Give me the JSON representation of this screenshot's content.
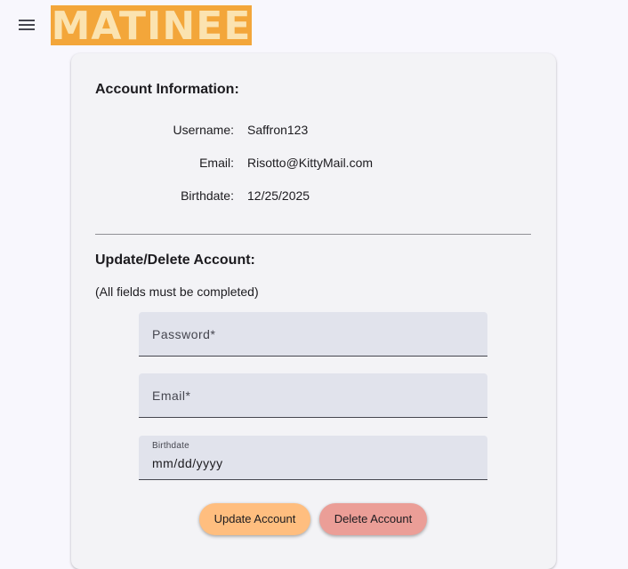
{
  "header": {
    "menu_icon": "hamburger-menu-icon",
    "logo_text": "MATINEE",
    "logo_color": "#f3a63a"
  },
  "account_info": {
    "title": "Account Information:",
    "rows": [
      {
        "label": "Username:",
        "value": "Saffron123"
      },
      {
        "label": "Email:",
        "value": "Risotto@KittyMail.com"
      },
      {
        "label": "Birthdate:",
        "value": "12/25/2025"
      }
    ]
  },
  "update_delete": {
    "title": "Update/Delete Account:",
    "note": "(All fields must be completed)",
    "password_placeholder": "Password*",
    "email_placeholder": "Email*",
    "birthdate_label": "Birthdate",
    "birthdate_value": "mm/dd/yyyy",
    "update_label": "Update Account",
    "delete_label": "Delete Account"
  },
  "colors": {
    "update_button": "#ffbe7f",
    "delete_button": "#eb9e97",
    "card_background": "#f3f3f6",
    "field_background": "#e1e3ec"
  }
}
